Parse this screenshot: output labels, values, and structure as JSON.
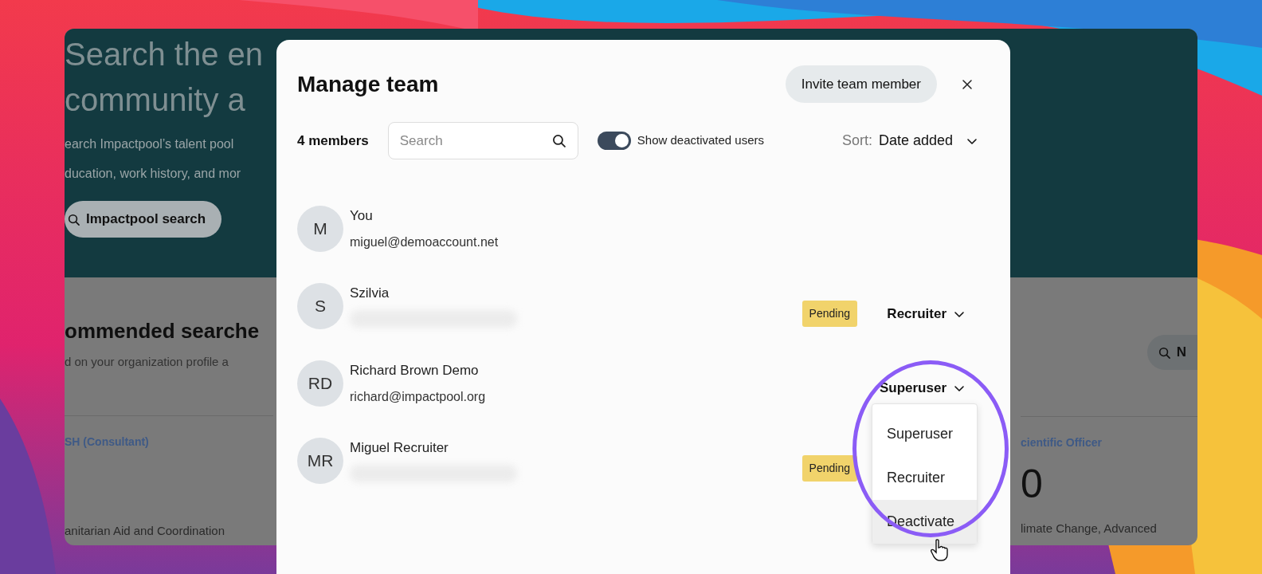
{
  "background_app": {
    "hero_title_lines": [
      "Search the en",
      "community a"
    ],
    "hero_text_lines": [
      "earch Impactpool’s talent pool",
      "ducation, work history, and mor"
    ],
    "hero_button": "Impactpool search",
    "section_title": "ommended searche",
    "section_subtitle": "d on your organization profile a",
    "left_card": {
      "title": "SH (Consultant)",
      "text": "anitarian Aid and Coordination"
    },
    "right_button": "N",
    "right_card": {
      "title": "cientific Officer",
      "number": "0",
      "text": "limate Change, Advanced"
    }
  },
  "modal": {
    "title": "Manage team",
    "invite_button": "Invite team member",
    "member_count": "4 members",
    "search": {
      "placeholder": "Search"
    },
    "show_deactivated": {
      "label": "Show deactivated users",
      "on": true
    },
    "sort": {
      "label": "Sort:",
      "value": "Date added"
    },
    "members": [
      {
        "initials": "M",
        "name": "You",
        "email": "miguel@demoaccount.net"
      },
      {
        "initials": "S",
        "name": "Szilvia",
        "email_redacted": true,
        "status": "Pending",
        "role": "Recruiter"
      },
      {
        "initials": "RD",
        "name": "Richard Brown Demo",
        "email": "richard@impactpool.org",
        "role": "Superuser",
        "role_menu": [
          {
            "label": "Superuser",
            "hovered": false
          },
          {
            "label": "Recruiter",
            "hovered": false
          },
          {
            "label": "Deactivate",
            "hovered": true
          }
        ]
      },
      {
        "initials": "MR",
        "name": "Miguel Recruiter",
        "email_redacted": true,
        "status": "Pending"
      }
    ]
  }
}
